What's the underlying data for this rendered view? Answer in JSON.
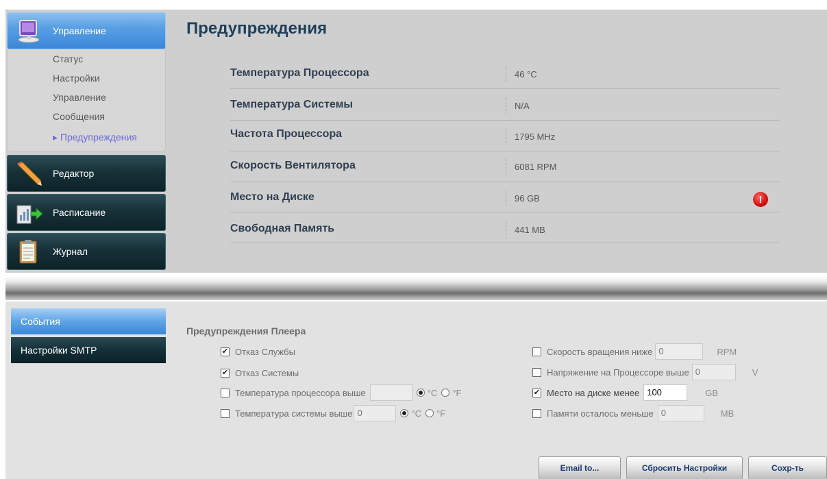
{
  "nav": {
    "main_items": [
      {
        "label": "Управление",
        "icon": "monitor-icon"
      },
      {
        "label": "Редактор",
        "icon": "pencil-icon"
      },
      {
        "label": "Расписание",
        "icon": "schedule-icon"
      },
      {
        "label": "Журнал",
        "icon": "clipboard-icon"
      }
    ],
    "submenu": [
      "Статус",
      "Настройки",
      "Управление",
      "Сообщения",
      "▸ Предупреждения"
    ]
  },
  "page": {
    "title": "Предупреждения",
    "rows": [
      {
        "label": "Температура Процессора",
        "value": "46 °C"
      },
      {
        "label": "Температура Системы",
        "value": "N/A"
      },
      {
        "label": "Частота Процессора",
        "value": "1795 MHz"
      },
      {
        "label": "Скорость Вентилятора",
        "value": "6081 RPM"
      },
      {
        "label": "Место на Диске",
        "value": "96 GB",
        "warning": true
      },
      {
        "label": "Свободная Память",
        "value": "441 MB"
      }
    ],
    "warning_icon": "exclamation-icon"
  },
  "bottom_tabs": {
    "events": "События",
    "smtp": "Настройки SMTP"
  },
  "player": {
    "title": "Предупреждения Плеера",
    "service_failure": {
      "label": "Отказ Службы",
      "checked": true
    },
    "system_failure": {
      "label": "Отказ Системы",
      "checked": true
    },
    "cpu_temp_above": {
      "label": "Температура процессора выше",
      "checked": false,
      "value": "",
      "unit_c": "°C",
      "unit_f": "°F",
      "selected": "°C"
    },
    "sys_temp_above": {
      "label": "Температура системы выше",
      "checked": false,
      "value": "0",
      "unit_c": "°C",
      "unit_f": "°F",
      "selected": "°C"
    },
    "fan_below": {
      "label": "Скорость вращения ниже",
      "checked": false,
      "value": "0",
      "unit": "RPM"
    },
    "cpu_voltage_above": {
      "label": "Напряжение на Процессоре выше",
      "checked": false,
      "value": "0",
      "unit": "V"
    },
    "disk_below": {
      "label": "Место на диске менее",
      "checked": true,
      "value": "100",
      "unit": "GB"
    },
    "memory_below": {
      "label": "Памяти осталось меньше",
      "checked": false,
      "value": "0",
      "unit": "MB"
    }
  },
  "buttons": {
    "email": "Email to...",
    "reset": "Сбросить Настройки",
    "save": "Сохр-ть"
  }
}
